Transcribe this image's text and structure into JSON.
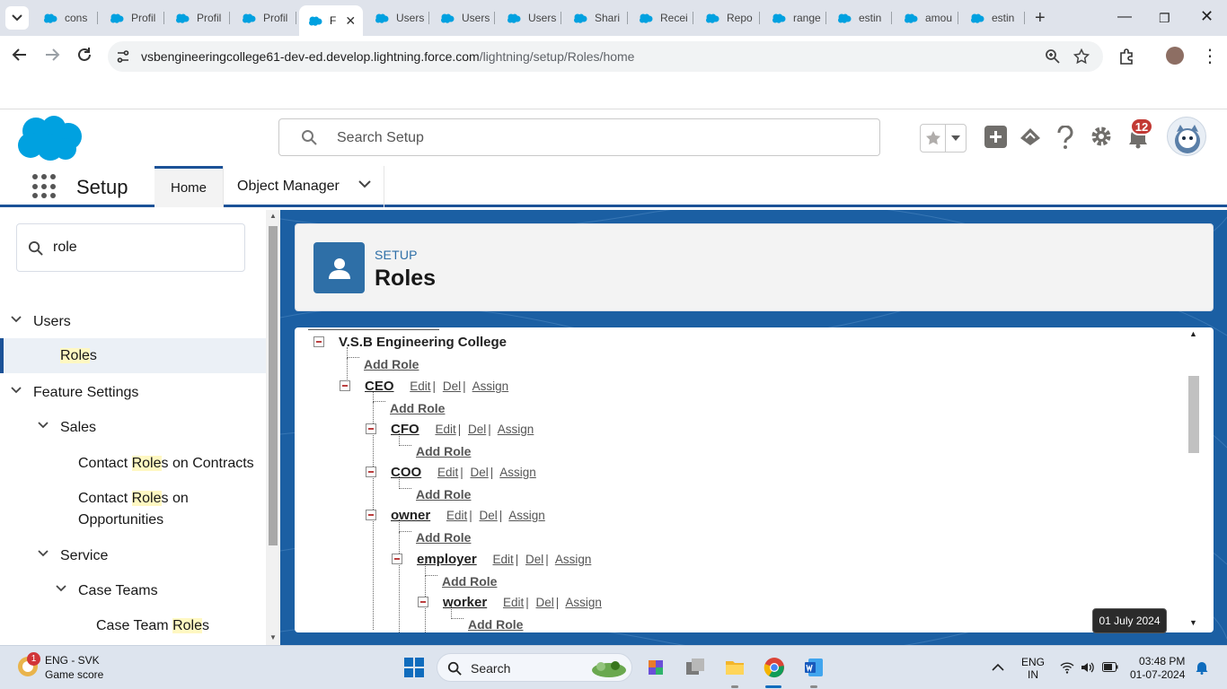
{
  "browser": {
    "tabs": [
      {
        "label": "cons"
      },
      {
        "label": "Profil"
      },
      {
        "label": "Profil"
      },
      {
        "label": "Profil"
      },
      {
        "label": "F"
      },
      {
        "label": "Users"
      },
      {
        "label": "Users"
      },
      {
        "label": "Users"
      },
      {
        "label": "Shari"
      },
      {
        "label": "Recei"
      },
      {
        "label": "Repo"
      },
      {
        "label": "range"
      },
      {
        "label": "estin"
      },
      {
        "label": "amou"
      },
      {
        "label": "estin"
      }
    ],
    "active_tab_index": 4,
    "url_host": "vsbengineeringcollege61-dev-ed.develop.lightning.force.com",
    "url_path": "/lightning/setup/Roles/home"
  },
  "header": {
    "search_placeholder": "Search Setup",
    "notification_count": "12"
  },
  "appnav": {
    "app_name": "Setup",
    "home_label": "Home",
    "object_manager_label": "Object Manager"
  },
  "sidebar": {
    "quickfind_value": "role",
    "items": [
      {
        "label": "Users"
      },
      {
        "label_hl": "Role",
        "label_rest": "s"
      },
      {
        "label": "Feature Settings"
      },
      {
        "label": "Sales"
      },
      {
        "label_pre": "Contact ",
        "label_hl": "Role",
        "label_rest": "s on Contracts"
      },
      {
        "label_pre": "Contact ",
        "label_hl": "Role",
        "label_rest": "s on",
        "label_line2": "Opportunities"
      },
      {
        "label": "Service"
      },
      {
        "label": "Case Teams"
      },
      {
        "label_pre": "Case Team ",
        "label_hl": "Role",
        "label_rest": "s"
      }
    ]
  },
  "page": {
    "eyebrow": "SETUP",
    "title": "Roles"
  },
  "roles": {
    "root": "V.S.B Engineering College",
    "add_role": "Add Role",
    "edit": "Edit",
    "del": "Del",
    "assign": "Assign",
    "sep": "|",
    "nodes": [
      {
        "name": "CEO"
      },
      {
        "name": "CFO"
      },
      {
        "name": "COO"
      },
      {
        "name": "owner"
      },
      {
        "name": "employer"
      },
      {
        "name": "worker"
      }
    ]
  },
  "taskbar": {
    "widget_badge": "1",
    "widget_line1": "ENG - SVK",
    "widget_line2": "Game score",
    "search_label": "Search",
    "lang_line1": "ENG",
    "lang_line2": "IN",
    "time": "03:48 PM",
    "date": "01-07-2024",
    "tooltip": "01 July 2024"
  },
  "colors": {
    "brand_blue": "#1b5297",
    "salesforce_cloud": "#00a1e0",
    "notification_red": "#c23934",
    "highlight": "#fff8c2"
  }
}
